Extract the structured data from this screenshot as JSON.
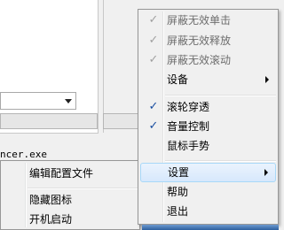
{
  "background": {
    "filename_fragment": "ncer.exe"
  },
  "main_menu": {
    "items": [
      {
        "label": "屏蔽无效单击",
        "checked": true,
        "enabled": false
      },
      {
        "label": "屏蔽无效释放",
        "checked": true,
        "enabled": false
      },
      {
        "label": "屏蔽无效滚动",
        "checked": true,
        "enabled": false
      },
      {
        "label": "设备",
        "has_submenu": true
      },
      {
        "label": "滚轮穿透",
        "checked": true,
        "enabled": true
      },
      {
        "label": "音量控制",
        "checked": true,
        "enabled": true
      },
      {
        "label": "鼠标手势",
        "checked": false,
        "enabled": true
      },
      {
        "label": "设置",
        "has_submenu": true,
        "highlighted": true
      },
      {
        "label": "帮助"
      },
      {
        "label": "退出"
      }
    ]
  },
  "settings_submenu": {
    "items": [
      {
        "label": "编辑配置文件"
      },
      {
        "label": "隐藏图标"
      },
      {
        "label": "开机启动"
      }
    ]
  },
  "glyphs": {
    "check": "✓"
  }
}
